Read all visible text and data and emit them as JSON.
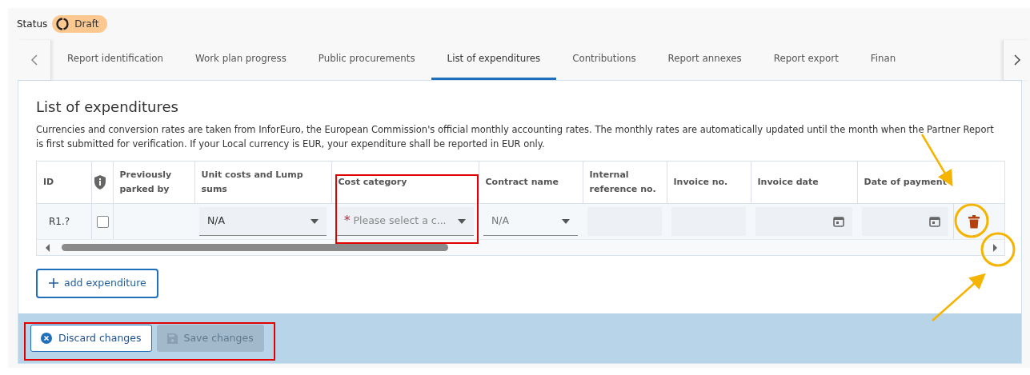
{
  "status": {
    "label": "Status",
    "value": "Draft"
  },
  "tabs": [
    {
      "label": "Report identification",
      "selected": false
    },
    {
      "label": "Work plan progress",
      "selected": false
    },
    {
      "label": "Public procurements",
      "selected": false
    },
    {
      "label": "List of expenditures",
      "selected": true
    },
    {
      "label": "Contributions",
      "selected": false
    },
    {
      "label": "Report annexes",
      "selected": false
    },
    {
      "label": "Report export",
      "selected": false
    },
    {
      "label": "Finan",
      "selected": false
    }
  ],
  "section": {
    "title": "List of expenditures",
    "description": "Currencies and conversion rates are taken from InforEuro, the European Commission's official monthly accounting rates. The monthly rates are automatically updated until the month when the Partner Report is first submitted for verification. If your Local currency is EUR, your expenditure shall be reported in EUR only."
  },
  "table": {
    "columns": [
      {
        "kind": "text",
        "label": "ID"
      },
      {
        "kind": "shield"
      },
      {
        "kind": "text",
        "label": "Previously parked by"
      },
      {
        "kind": "text",
        "label": "Unit costs and Lump sums"
      },
      {
        "kind": "text",
        "label": "Cost category"
      },
      {
        "kind": "text",
        "label": "Contract name"
      },
      {
        "kind": "text",
        "label": "Internal reference no."
      },
      {
        "kind": "text",
        "label": "Invoice no."
      },
      {
        "kind": "text",
        "label": "Invoice date"
      },
      {
        "kind": "text",
        "label": "Date of payment"
      },
      {
        "kind": "blank"
      }
    ],
    "rows": [
      {
        "cells": [
          {
            "kind": "text",
            "text": "R1.?"
          },
          {
            "kind": "checkbox",
            "checked": false
          },
          {
            "kind": "blank"
          },
          {
            "kind": "select",
            "value": "N/A",
            "disabled": false
          },
          {
            "kind": "select",
            "placeholder": "Please select a c...",
            "required": true,
            "required_mark": "*",
            "disabled": false
          },
          {
            "kind": "select",
            "value": "N/A",
            "disabled": true
          },
          {
            "kind": "input"
          },
          {
            "kind": "input"
          },
          {
            "kind": "date"
          },
          {
            "kind": "date"
          },
          {
            "kind": "delete"
          }
        ]
      }
    ]
  },
  "add_button": "add expenditure",
  "footer": [
    {
      "kind": "discard",
      "label": "Discard changes",
      "disabled": false
    },
    {
      "kind": "save",
      "label": "Save changes",
      "disabled": true
    }
  ]
}
